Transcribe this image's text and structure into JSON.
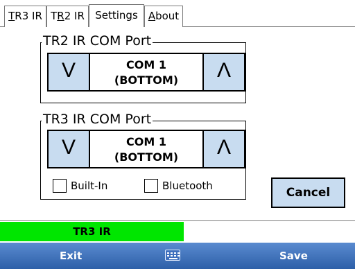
{
  "tabs": [
    {
      "label_pre": "",
      "label_ul": "T",
      "label_post": "R3 IR"
    },
    {
      "label_pre": "T",
      "label_ul": "R",
      "label_post": "2 IR"
    },
    {
      "label_pre": "Settin",
      "label_ul": "g",
      "label_post": "s"
    },
    {
      "label_pre": "",
      "label_ul": "A",
      "label_post": "bout"
    }
  ],
  "tr2_group": {
    "title": "TR2 IR COM Port",
    "down_label": "V",
    "up_label": "Λ",
    "com_line1": "COM 1",
    "com_line2": "(BOTTOM)"
  },
  "tr3_group": {
    "title": "TR3 IR COM Port",
    "down_label": "V",
    "up_label": "Λ",
    "com_line1": "COM 1",
    "com_line2": "(BOTTOM)",
    "builtin_label": "Built-In",
    "bluetooth_label": "Bluetooth"
  },
  "cancel_label": "Cancel",
  "status": {
    "label": "TR3 IR",
    "color": "#00e600"
  },
  "softkeys": {
    "left": "Exit",
    "right": "Save",
    "center_icon": "keyboard-icon"
  }
}
